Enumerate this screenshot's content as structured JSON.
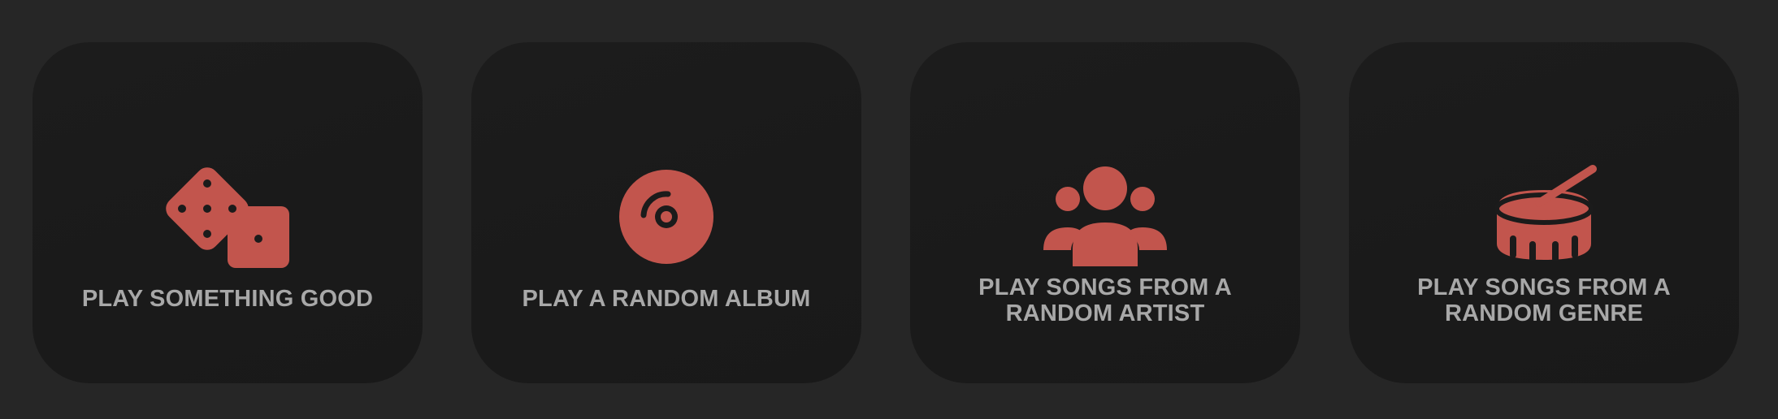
{
  "accent_color": "#c2554d",
  "cards": [
    {
      "label": "PLAY SOMETHING GOOD",
      "icon": "dice-icon"
    },
    {
      "label": "PLAY A RANDOM ALBUM",
      "icon": "vinyl-disc-icon"
    },
    {
      "label": "PLAY SONGS FROM A\nRANDOM ARTIST",
      "icon": "users-group-icon"
    },
    {
      "label": "PLAY SONGS FROM A\nRANDOM GENRE",
      "icon": "drum-icon"
    }
  ]
}
